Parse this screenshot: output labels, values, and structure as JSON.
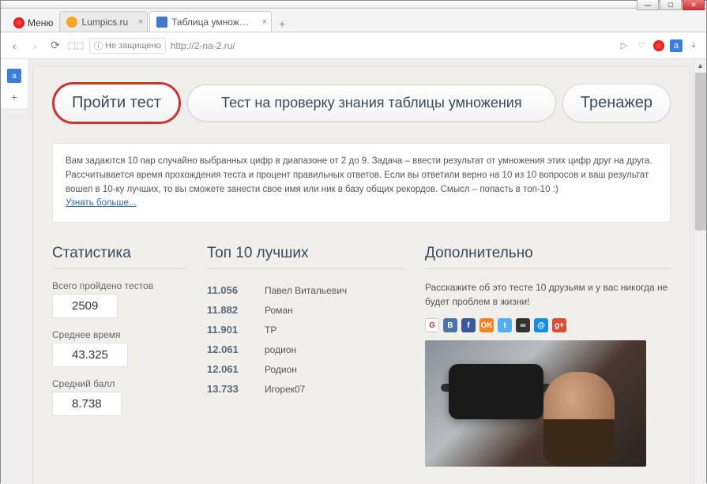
{
  "window": {
    "menu": "Меню"
  },
  "tabs": [
    {
      "label": "Lumpics.ru",
      "favicon_color": "#f5a623"
    },
    {
      "label": "Таблица умножения трен",
      "favicon_color": "#4477cc"
    }
  ],
  "addressbar": {
    "secure_label": "Не защищено",
    "url": "http://2-na-2.ru/"
  },
  "nav": {
    "take_test": "Пройти тест",
    "middle": "Тест на проверку знания таблицы умножения",
    "trainer": "Тренажер"
  },
  "description": {
    "text": "Вам задаются 10 пар случайно выбранных цифр в диапазоне от 2 до 9. Задача – ввести результат от умножения этих цифр друг на друга. Рассчитывается время прохождения теста и процент правильных ответов. Если вы ответили верно на 10 из 10 вопросов и ваш результат вошел в 10-ку лучших, то вы сможете занести свое имя или ник в базу общих рекордов. Смысл – попасть в топ-10 :)",
    "more": "Узнать больше..."
  },
  "stats": {
    "title": "Статистика",
    "total_label": "Всего пройдено тестов",
    "total_value": "2509",
    "avgtime_label": "Среднее время",
    "avgtime_value": "43.325",
    "avgscore_label": "Средний балл",
    "avgscore_value": "8.738"
  },
  "top10": {
    "title": "Топ 10 лучших",
    "rows": [
      {
        "score": "11.056",
        "name": "Павел Витальевич"
      },
      {
        "score": "11.882",
        "name": "Роман"
      },
      {
        "score": "11.901",
        "name": "ТР"
      },
      {
        "score": "12.061",
        "name": "родион"
      },
      {
        "score": "12.061",
        "name": "Родион"
      },
      {
        "score": "13.733",
        "name": "Игорек07"
      }
    ]
  },
  "extra": {
    "title": "Дополнительно",
    "text": "Расскажите об это тесте 10 друзьям и у вас никогда не будет проблем в жизни!",
    "social": [
      {
        "bg": "#fff",
        "fg": "#c33",
        "t": "G"
      },
      {
        "bg": "#4c75a3",
        "fg": "#fff",
        "t": "B"
      },
      {
        "bg": "#3b5998",
        "fg": "#fff",
        "t": "f"
      },
      {
        "bg": "#f48420",
        "fg": "#fff",
        "t": "OK"
      },
      {
        "bg": "#55acee",
        "fg": "#fff",
        "t": "t"
      },
      {
        "bg": "#333",
        "fg": "#fff",
        "t": "∞"
      },
      {
        "bg": "#168de2",
        "fg": "#fff",
        "t": "@"
      },
      {
        "bg": "#dd4b39",
        "fg": "#fff",
        "t": "g+"
      }
    ]
  }
}
